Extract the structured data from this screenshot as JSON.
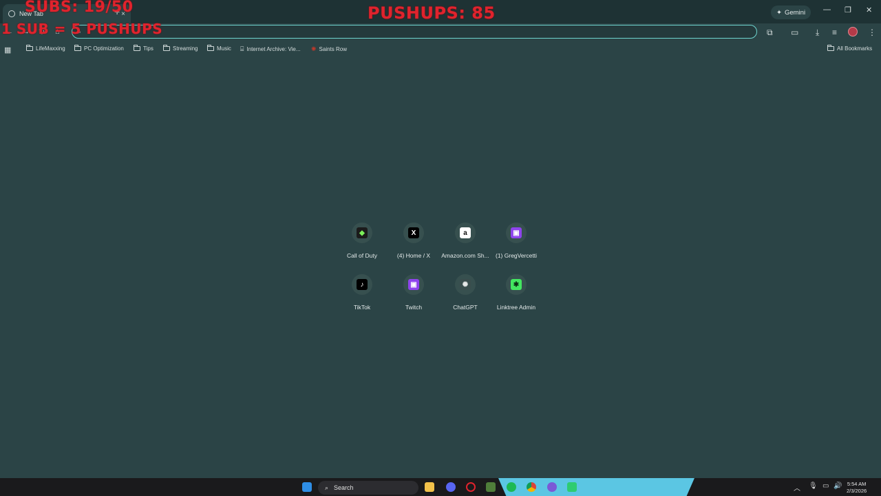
{
  "browser": {
    "tab_title": "New Tab",
    "tab_close": "×",
    "new_tab": "+",
    "gemini_label": "Gemini",
    "window": {
      "minimize": "—",
      "restore": "❐",
      "close": "✕"
    },
    "nav": {
      "back": "←",
      "forward": "→",
      "reload": "↻",
      "home": "⌂"
    },
    "omnibox": {
      "value": "",
      "placeholder": ""
    }
  },
  "overlay": {
    "subs": "SUBS: 19/50",
    "rule": "1 SUB = 5 PUSHUPS",
    "pushups": "PUSHUPS: 85"
  },
  "bookmarks": [
    {
      "label": "LifeMaxxing",
      "icon": "folder-icon"
    },
    {
      "label": "PC Optimization",
      "icon": "folder-icon"
    },
    {
      "label": "Tips",
      "icon": "folder-icon"
    },
    {
      "label": "Streaming",
      "icon": "folder-icon"
    },
    {
      "label": "Music",
      "icon": "folder-icon"
    },
    {
      "label": "Internet Archive: Vie...",
      "icon": "archive-icon"
    },
    {
      "label": "Saints Row",
      "icon": "saints-row-icon"
    }
  ],
  "all_bookmarks": "All Bookmarks",
  "shortcuts": [
    {
      "label": "Call of Duty",
      "icon": "call-of-duty-icon",
      "glyph": "◆",
      "bg": "#1b1b1b",
      "fg": "#7cf05a"
    },
    {
      "label": "(4) Home / X",
      "icon": "x-icon",
      "glyph": "X",
      "bg": "#000000",
      "fg": "#ffffff"
    },
    {
      "label": "Amazon.com Sh...",
      "icon": "amazon-icon",
      "glyph": "a",
      "bg": "#ffffff",
      "fg": "#111111"
    },
    {
      "label": "(1) GregVercetti",
      "icon": "twitch-icon",
      "glyph": "▣",
      "bg": "#8e44ec",
      "fg": "#ffffff"
    },
    {
      "label": "TikTok",
      "icon": "tiktok-icon",
      "glyph": "♪",
      "bg": "#000000",
      "fg": "#ffffff"
    },
    {
      "label": "Twitch",
      "icon": "twitch-icon",
      "glyph": "▣",
      "bg": "#8e44ec",
      "fg": "#ffffff"
    },
    {
      "label": "ChatGPT",
      "icon": "chatgpt-icon",
      "glyph": "✺",
      "bg": "#3a4d4d",
      "fg": "#e8e8e8"
    },
    {
      "label": "Linktree Admin",
      "icon": "linktree-icon",
      "glyph": "✱",
      "bg": "#43e660",
      "fg": "#0b2d14"
    }
  ],
  "taskbar": {
    "search_label": "Search",
    "time": "5:54 AM",
    "date": "2/3/2026"
  }
}
